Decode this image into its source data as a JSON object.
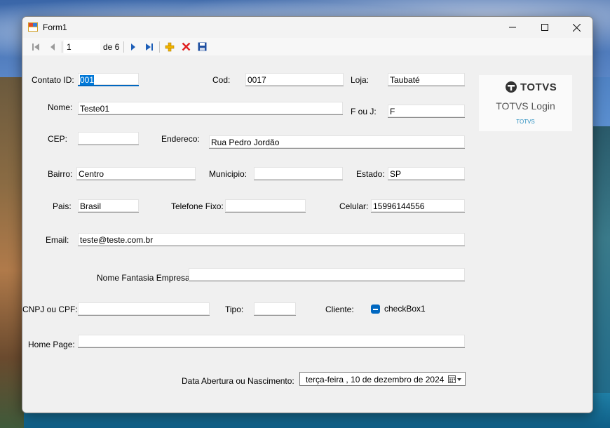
{
  "window": {
    "title": "Form1"
  },
  "toolbar": {
    "position_value": "1",
    "of_label": "de 6"
  },
  "form": {
    "contato_id": {
      "label": "Contato ID:",
      "value": "001"
    },
    "cod": {
      "label": "Cod:",
      "value": "0017"
    },
    "loja": {
      "label": "Loja:",
      "value": "Taubaté"
    },
    "nome": {
      "label": "Nome:",
      "value": "Teste01"
    },
    "f_ou_j": {
      "label": "F ou J:",
      "value": "F"
    },
    "cep": {
      "label": "CEP:",
      "value": ""
    },
    "endereco": {
      "label": "Endereco:",
      "value": "Rua Pedro Jordão"
    },
    "bairro": {
      "label": "Bairro:",
      "value": "Centro"
    },
    "municipio": {
      "label": "Municipio:",
      "value": ""
    },
    "estado": {
      "label": "Estado:",
      "value": "SP"
    },
    "pais": {
      "label": "Pais:",
      "value": "Brasil"
    },
    "telefone_fixo": {
      "label": "Telefone Fixo:",
      "value": ""
    },
    "celular": {
      "label": "Celular:",
      "value": "15996144556"
    },
    "email": {
      "label": "Email:",
      "value": "teste@teste.com.br"
    },
    "nome_fantasia": {
      "label": "Nome Fantasia Empresa:",
      "value": ""
    },
    "cnpj_cpf": {
      "label": "CNPJ ou CPF:",
      "value": ""
    },
    "tipo": {
      "label": "Tipo:",
      "value": ""
    },
    "cliente": {
      "label": "Cliente:",
      "checkbox_label": "checkBox1",
      "state": "indeterminate"
    },
    "home_page": {
      "label": "Home Page:",
      "value": ""
    },
    "data_abertura": {
      "label": "Data Abertura ou Nascimento:",
      "value": "terça-feira   , 10 de dezembro de 2024"
    }
  },
  "totvs_panel": {
    "brand": "TOTVS",
    "subtitle": "TOTVS Login",
    "small": "TOTVS"
  },
  "colors": {
    "accent": "#0067c0",
    "selection": "#0078d7",
    "window_bg": "#f0f0f0"
  }
}
